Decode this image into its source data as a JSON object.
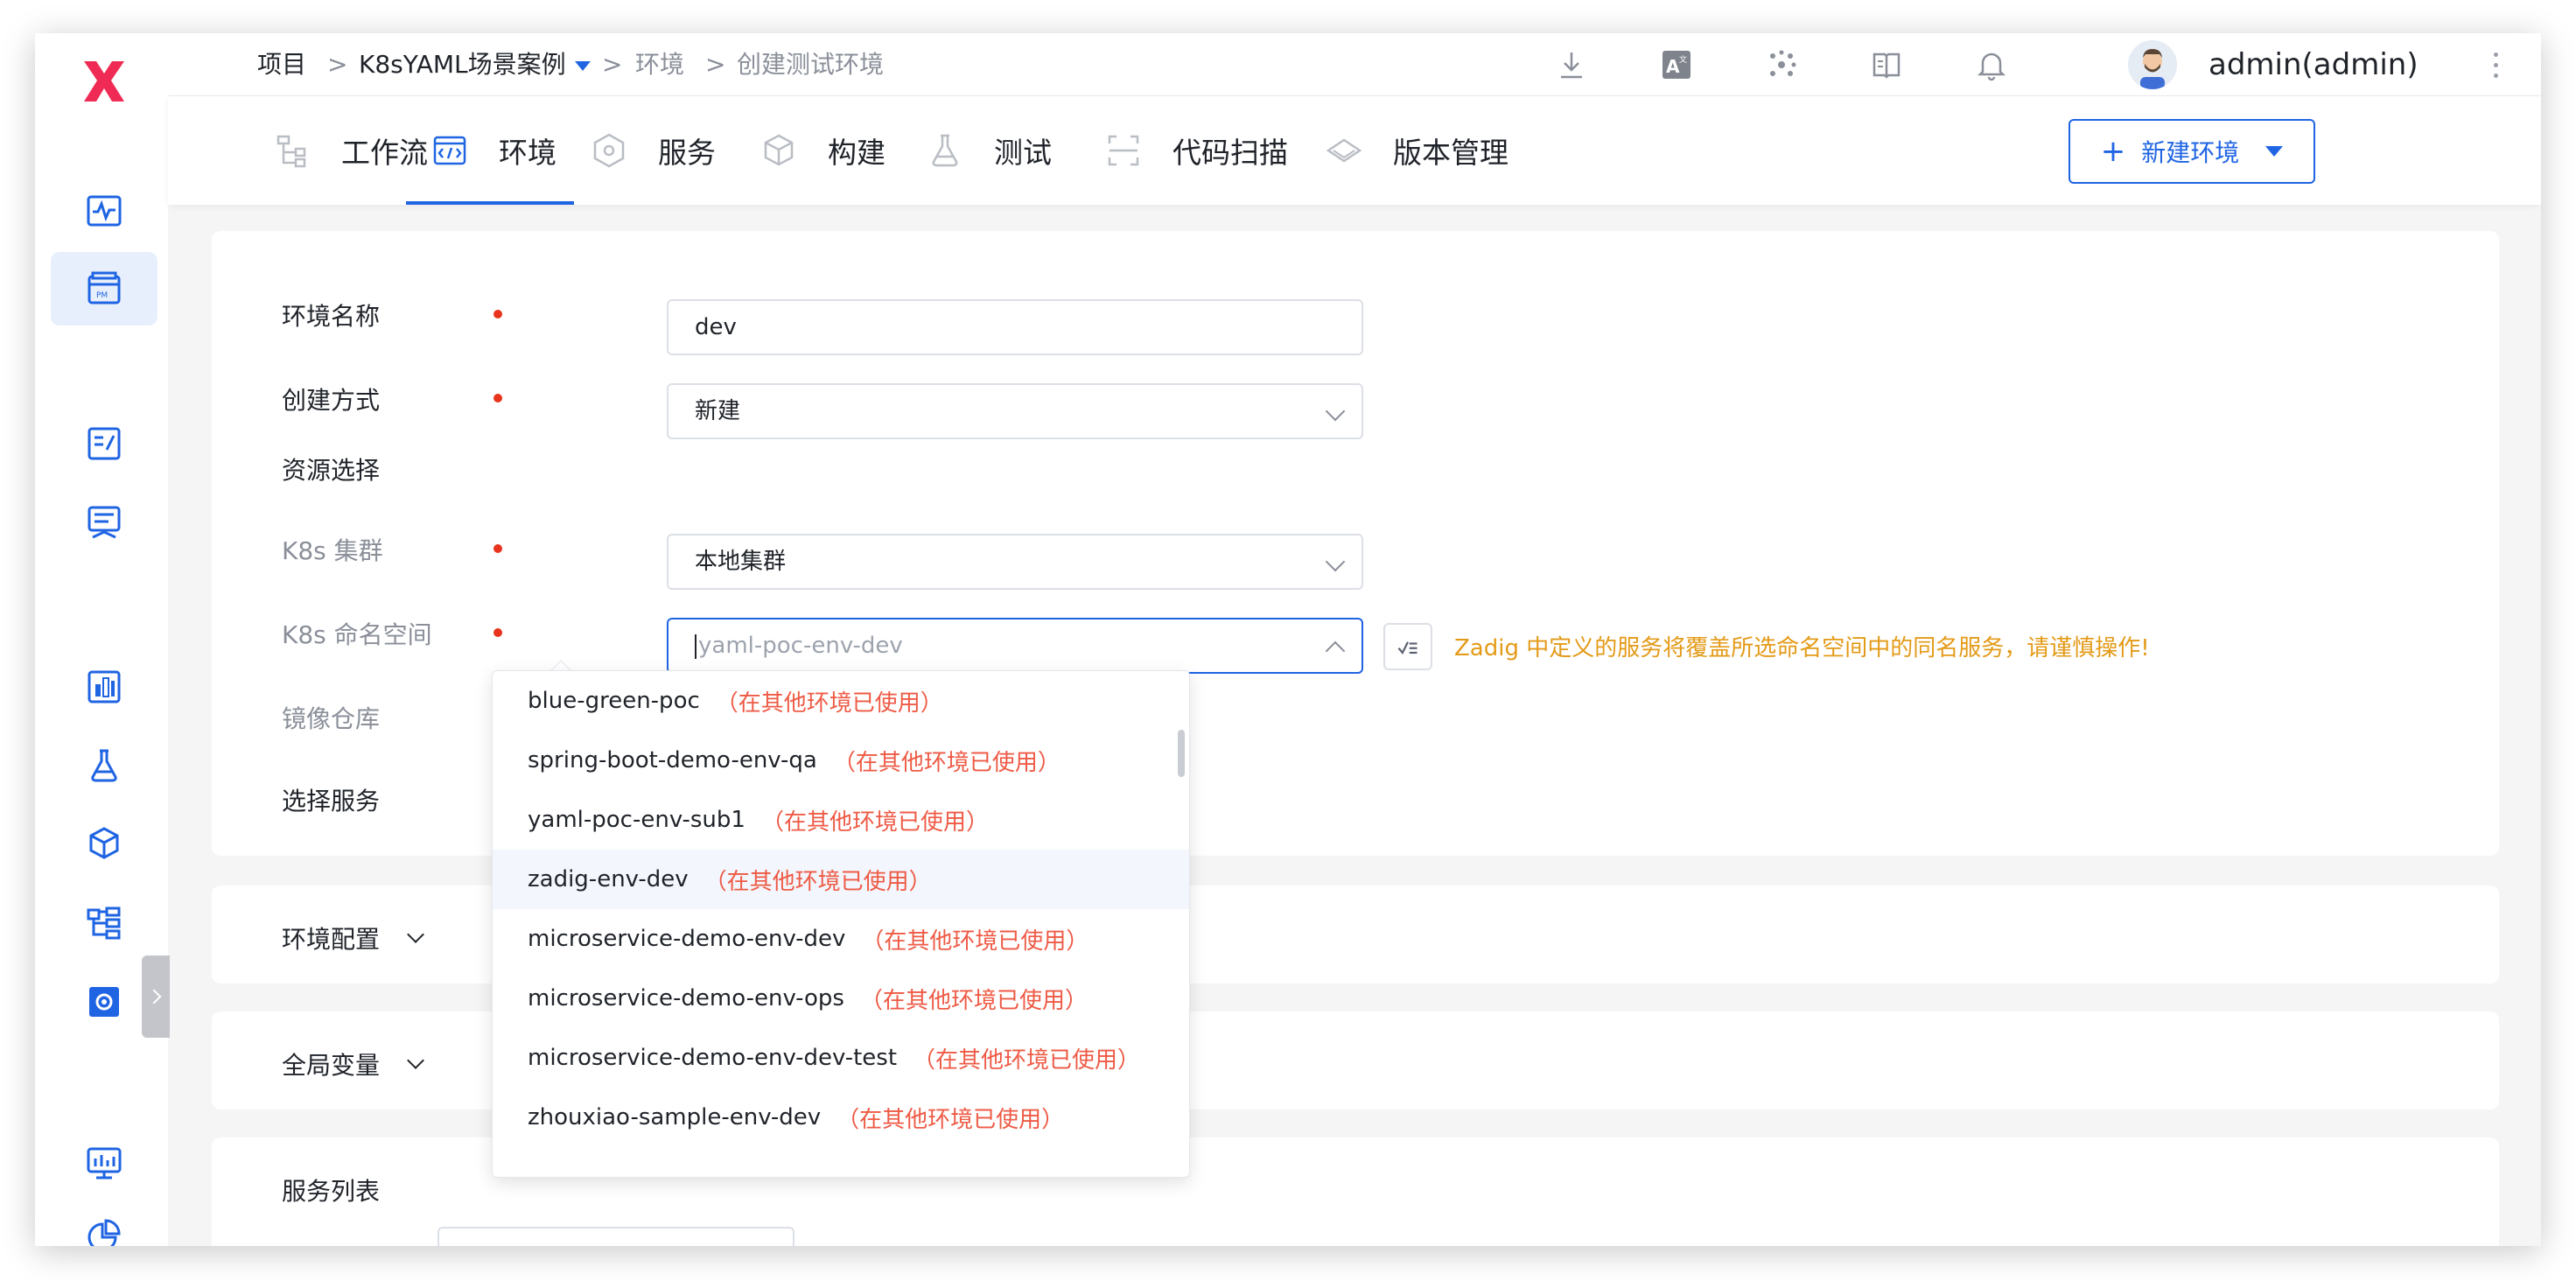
{
  "breadcrumb": {
    "root": "项目",
    "sep": ">",
    "project": "K8sYAML场景案例",
    "section": "环境",
    "current": "创建测试环境"
  },
  "user": {
    "name": "admin(admin)"
  },
  "tabs": [
    {
      "label": "工作流",
      "icon": "workflow-icon"
    },
    {
      "label": "环境",
      "icon": "environment-icon",
      "active": true
    },
    {
      "label": "服务",
      "icon": "service-icon"
    },
    {
      "label": "构建",
      "icon": "build-icon"
    },
    {
      "label": "测试",
      "icon": "test-flask-icon"
    },
    {
      "label": "代码扫描",
      "icon": "code-scan-icon"
    },
    {
      "label": "版本管理",
      "icon": "version-icon"
    }
  ],
  "actions": {
    "new_env": "新建环境"
  },
  "form": {
    "env_name_label": "环境名称",
    "env_name_value": "dev",
    "create_mode_label": "创建方式",
    "create_mode_value": "新建",
    "resource_label": "资源选择",
    "cluster_label": "K8s 集群",
    "cluster_value": "本地集群",
    "namespace_label": "K8s 命名空间",
    "namespace_placeholder": "yaml-poc-env-dev",
    "namespace_warning": "Zadig 中定义的服务将覆盖所选命名空间中的同名服务，请谨慎操作!",
    "registry_label": "镜像仓库",
    "services_label": "选择服务"
  },
  "namespace_options": [
    {
      "name": "blue-green-poc",
      "note": "（在其他环境已使用）"
    },
    {
      "name": "spring-boot-demo-env-qa",
      "note": "（在其他环境已使用）"
    },
    {
      "name": "yaml-poc-env-sub1",
      "note": "（在其他环境已使用）"
    },
    {
      "name": "zadig-env-dev",
      "note": "（在其他环境已使用）",
      "hover": true
    },
    {
      "name": "microservice-demo-env-dev",
      "note": "（在其他环境已使用）"
    },
    {
      "name": "microservice-demo-env-ops",
      "note": "（在其他环境已使用）"
    },
    {
      "name": "microservice-demo-env-dev-test",
      "note": "（在其他环境已使用）"
    },
    {
      "name": "zhouxiao-sample-env-dev",
      "note": "（在其他环境已使用）"
    }
  ],
  "sections": {
    "env_config": "环境配置",
    "global_vars": "全局变量",
    "service_list": "服务列表"
  },
  "colors": {
    "primary": "#1f64e3",
    "required": "#e8341c",
    "warning": "#e39a17",
    "used_note": "#ee5a45"
  }
}
